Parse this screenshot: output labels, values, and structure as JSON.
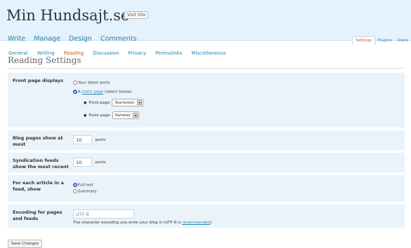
{
  "header": {
    "site_title": "Min Hundsajt.se",
    "visit_site": "Visit Site",
    "main_menu": [
      "Write",
      "Manage",
      "Design",
      "Comments"
    ],
    "right_menu": [
      "Settings",
      "Plugins",
      "Users"
    ]
  },
  "submenu": [
    "General",
    "Writing",
    "Reading",
    "Discussion",
    "Privacy",
    "Permalinks",
    "Miscellaneous"
  ],
  "page_title": "Reading Settings",
  "front_page": {
    "label": "Front page displays",
    "option_latest": "Your latest posts",
    "option_static_prefix": "A ",
    "option_static_link": "static page",
    "option_static_suffix": " (select below)",
    "front_page_label": "Front page:",
    "front_page_value": "Startsidan",
    "posts_page_label": "Posts page:",
    "posts_page_value": "Nyheter"
  },
  "blog_pages": {
    "label": "Blog pages show at most",
    "value": "10",
    "unit": "posts"
  },
  "syndication": {
    "label": "Syndication feeds show the most recent",
    "value": "10",
    "unit": "posts"
  },
  "feed_article": {
    "label": "For each article in a feed, show",
    "option_full": "Full text",
    "option_summary": "Summary"
  },
  "encoding": {
    "label": "Encoding for pages and feeds",
    "value": "UTF-8",
    "help_prefix": "The character encoding you write your blog in (UTF-8 is ",
    "help_link": "recommended",
    "help_suffix": ")"
  },
  "save_button": "Save Changes",
  "colors": {
    "header_bg": "#e4f2fd",
    "link": "#2583ad",
    "current": "#d54e21",
    "row_bg": "#eaf3fa"
  }
}
